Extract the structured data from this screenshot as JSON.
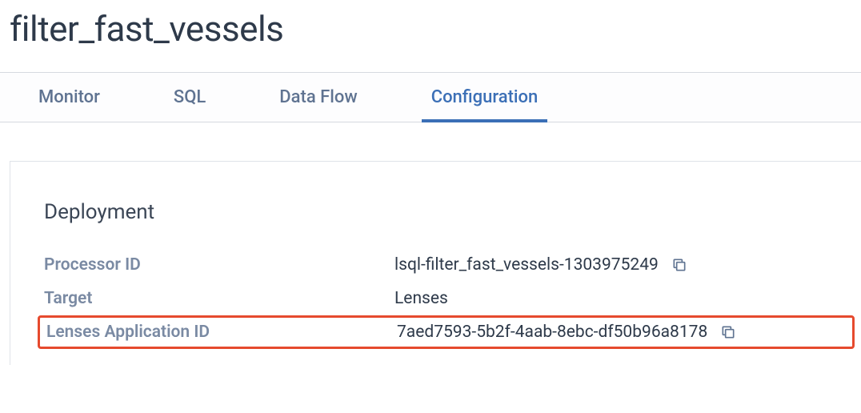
{
  "page": {
    "title": "filter_fast_vessels"
  },
  "tabs": {
    "monitor": "Monitor",
    "sql": "SQL",
    "dataflow": "Data Flow",
    "configuration": "Configuration"
  },
  "deployment": {
    "section_title": "Deployment",
    "processor_id": {
      "label": "Processor ID",
      "value": "lsql-filter_fast_vessels-1303975249"
    },
    "target": {
      "label": "Target",
      "value": "Lenses"
    },
    "lenses_app_id": {
      "label": "Lenses Application ID",
      "value": "7aed7593-5b2f-4aab-8ebc-df50b96a8178"
    }
  }
}
